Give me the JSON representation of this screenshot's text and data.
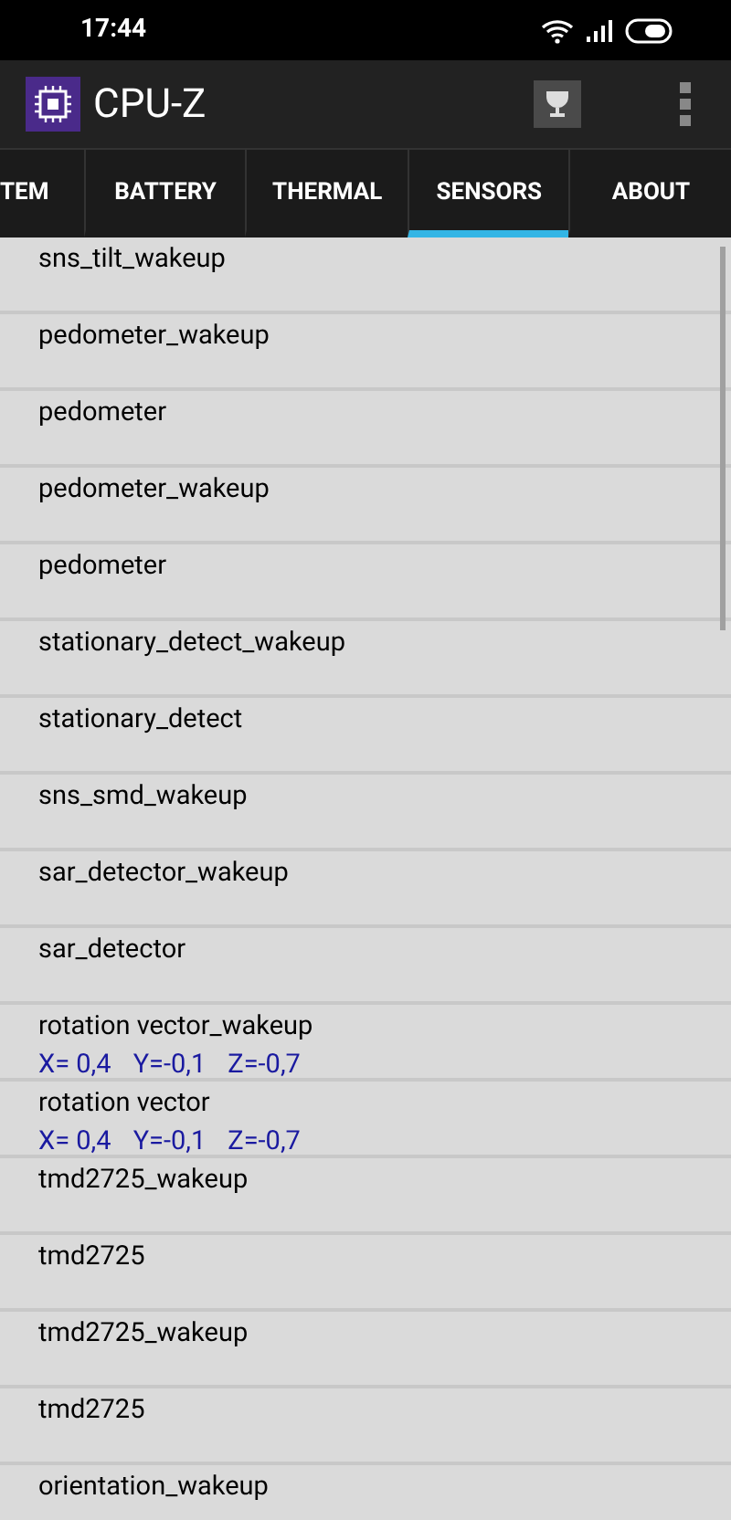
{
  "status_bar": {
    "time": "17:44"
  },
  "app_bar": {
    "title": "CPU-Z"
  },
  "tabs": [
    {
      "label": "TEM",
      "selected": false
    },
    {
      "label": "BATTERY",
      "selected": false
    },
    {
      "label": "THERMAL",
      "selected": false
    },
    {
      "label": "SENSORS",
      "selected": true
    },
    {
      "label": "ABOUT",
      "selected": false
    }
  ],
  "sensors": [
    {
      "name": "sns_tilt_wakeup"
    },
    {
      "name": "pedometer_wakeup"
    },
    {
      "name": "pedometer"
    },
    {
      "name": "pedometer_wakeup"
    },
    {
      "name": "pedometer"
    },
    {
      "name": "stationary_detect_wakeup"
    },
    {
      "name": "stationary_detect"
    },
    {
      "name": "sns_smd_wakeup"
    },
    {
      "name": "sar_detector_wakeup"
    },
    {
      "name": "sar_detector"
    },
    {
      "name": "rotation vector_wakeup",
      "values": [
        "X= 0,4",
        "Y=-0,1",
        "Z=-0,7"
      ]
    },
    {
      "name": "rotation vector",
      "values": [
        "X= 0,4",
        "Y=-0,1",
        "Z=-0,7"
      ]
    },
    {
      "name": "tmd2725_wakeup"
    },
    {
      "name": "tmd2725"
    },
    {
      "name": "tmd2725_wakeup"
    },
    {
      "name": "tmd2725"
    },
    {
      "name": "orientation_wakeup"
    }
  ]
}
